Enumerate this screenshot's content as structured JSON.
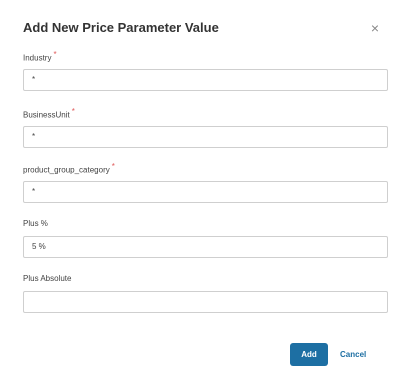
{
  "dialog": {
    "title": "Add New Price Parameter Value",
    "close_glyph": "×",
    "close_icon": "close-icon"
  },
  "fields": [
    {
      "label": "Industry",
      "required_mark": "*",
      "value": "*"
    },
    {
      "label": "BusinessUnit",
      "required_mark": "*",
      "value": "*"
    },
    {
      "label": "product_group_category",
      "required_mark": "*",
      "value": "*"
    },
    {
      "label": "Plus %",
      "required_mark": "",
      "value": "5 %"
    },
    {
      "label": "Plus Absolute",
      "required_mark": "",
      "value": ""
    }
  ],
  "footer": {
    "add_label": "Add",
    "cancel_label": "Cancel"
  },
  "colors": {
    "primary": "#1d6fa3",
    "required": "#e05a5a",
    "border": "#cfcfcf"
  }
}
